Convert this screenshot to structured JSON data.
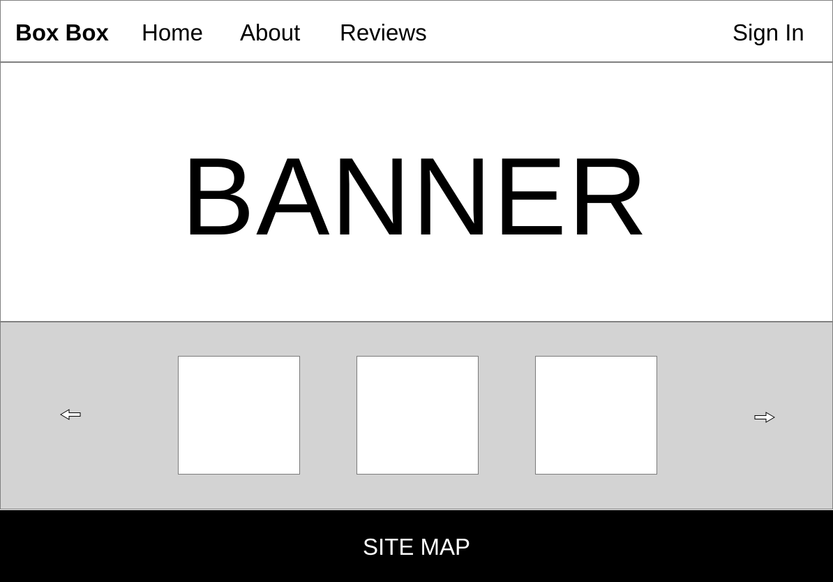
{
  "header": {
    "logo": "Box Box",
    "nav": {
      "home": "Home",
      "about": "About",
      "reviews": "Reviews"
    },
    "sign_in": "Sign In"
  },
  "banner": {
    "text": "BANNER"
  },
  "carousel": {
    "prev_icon": "arrow-left-icon",
    "next_icon": "arrow-right-icon",
    "card_count": 3,
    "background_color": "#d3d3d3"
  },
  "footer": {
    "text": "SITE MAP",
    "background_color": "#000000",
    "text_color": "#ffffff"
  }
}
